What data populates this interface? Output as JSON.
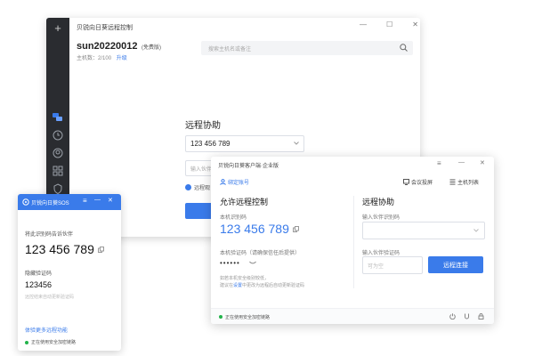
{
  "main_window": {
    "title": "贝锐向日葵远程控制",
    "username": "sun20220012",
    "edition": "(免费版)",
    "host_count_label": "主机数：",
    "host_count_value": "2/100",
    "upgrade_link": "升级",
    "search_placeholder": "搜索主机名或备注",
    "panel_title": "远程协助",
    "code_select_value": "123 456 789",
    "verify_placeholder": "输入伙伴",
    "radio_label": "远程观",
    "add_glyph": "+",
    "minimize_glyph": "—",
    "maximize_glyph": "☐",
    "close_glyph": "✕"
  },
  "sos_window": {
    "title": "贝锐向日葵SOS",
    "tell_label": "将此识别码告诉伙伴",
    "id_code": "123 456 789",
    "temp_code_label": "隐藏验证码",
    "temp_code": "123456",
    "temp_code_hint": "远控结束自动更新验证码",
    "more_link": "体验更多远程功能",
    "status": "正在使用安全加密链路"
  },
  "enterprise_window": {
    "title": "贝锐向日葵客户端·企业版",
    "bind_account": "绑定账号",
    "meeting_label": "会议投屏",
    "host_list_label": "主机列表",
    "allow_title": "允许远程控制",
    "local_id_label": "本机识别码",
    "local_id": "123 456 789",
    "local_code_label": "本机验证码（请确保信任后提供）",
    "local_code_masked": "••••••",
    "security_note_1": "如若本机安全级别较低，",
    "security_note_2_prefix": "建议在",
    "security_note_2_link": "设置",
    "security_note_2_suffix": "中更改为远程后自动更新验证码",
    "assist_title": "远程协助",
    "partner_id_label": "输入伙伴识别码",
    "partner_code_label": "输入伙伴验证码",
    "partner_code_placeholder": "可为空",
    "connect_button": "远程连接",
    "status": "正在使用安全加密链路"
  },
  "colors": {
    "accent": "#3a7bea",
    "sidebar": "#2a2c30",
    "status_green": "#22b34a"
  }
}
